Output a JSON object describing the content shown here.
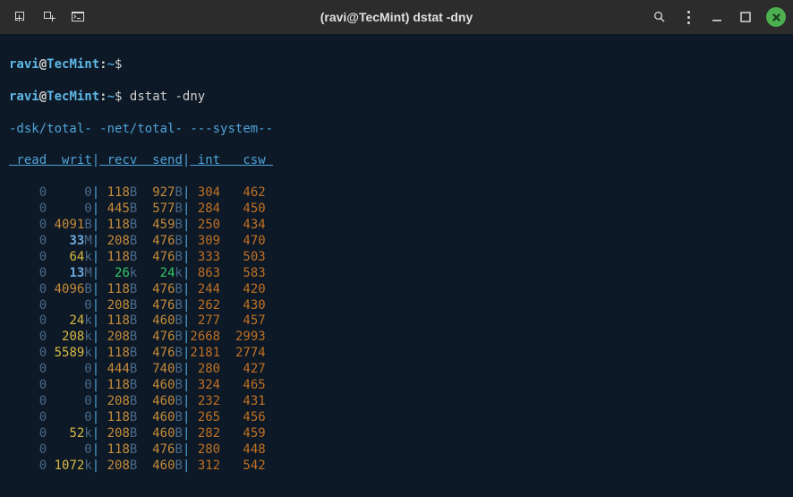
{
  "window": {
    "title": "(ravi@TecMint) dstat -dny"
  },
  "prompt": {
    "user": "ravi",
    "host": "TecMint",
    "path": "~",
    "symbol": "$"
  },
  "command": "dstat -dny",
  "groups": [
    {
      "label": "-dsk/total-",
      "cols": [
        "read",
        "writ"
      ]
    },
    {
      "label": "-net/total-",
      "cols": [
        "recv",
        "send"
      ]
    },
    {
      "label": "---system--",
      "cols": [
        "int",
        "csw"
      ]
    }
  ],
  "rows": [
    {
      "read": {
        "v": 0
      },
      "writ": {
        "v": 0
      },
      "recv": {
        "v": 118,
        "s": "B"
      },
      "send": {
        "v": 927,
        "s": "B"
      },
      "int": {
        "v": 304
      },
      "csw": {
        "v": 462
      }
    },
    {
      "read": {
        "v": 0
      },
      "writ": {
        "v": 0
      },
      "recv": {
        "v": 445,
        "s": "B"
      },
      "send": {
        "v": 577,
        "s": "B"
      },
      "int": {
        "v": 284
      },
      "csw": {
        "v": 450
      }
    },
    {
      "read": {
        "v": 0
      },
      "writ": {
        "v": 4091,
        "s": "B"
      },
      "recv": {
        "v": 118,
        "s": "B"
      },
      "send": {
        "v": 459,
        "s": "B"
      },
      "int": {
        "v": 250
      },
      "csw": {
        "v": 434
      }
    },
    {
      "read": {
        "v": 0
      },
      "writ": {
        "v": 33,
        "s": "M",
        "blue": true
      },
      "recv": {
        "v": 208,
        "s": "B"
      },
      "send": {
        "v": 476,
        "s": "B"
      },
      "int": {
        "v": 309
      },
      "csw": {
        "v": 470
      }
    },
    {
      "read": {
        "v": 0
      },
      "writ": {
        "v": 64,
        "s": "k",
        "y": true
      },
      "recv": {
        "v": 118,
        "s": "B"
      },
      "send": {
        "v": 476,
        "s": "B"
      },
      "int": {
        "v": 333
      },
      "csw": {
        "v": 503
      }
    },
    {
      "read": {
        "v": 0
      },
      "writ": {
        "v": 13,
        "s": "M",
        "blue": true
      },
      "recv": {
        "v": 26,
        "s": "k",
        "g": true
      },
      "send": {
        "v": 24,
        "s": "k",
        "g": true
      },
      "int": {
        "v": 863
      },
      "csw": {
        "v": 583
      }
    },
    {
      "read": {
        "v": 0
      },
      "writ": {
        "v": 4096,
        "s": "B"
      },
      "recv": {
        "v": 118,
        "s": "B"
      },
      "send": {
        "v": 476,
        "s": "B"
      },
      "int": {
        "v": 244
      },
      "csw": {
        "v": 420
      }
    },
    {
      "read": {
        "v": 0
      },
      "writ": {
        "v": 0
      },
      "recv": {
        "v": 208,
        "s": "B"
      },
      "send": {
        "v": 476,
        "s": "B"
      },
      "int": {
        "v": 262
      },
      "csw": {
        "v": 430
      }
    },
    {
      "read": {
        "v": 0
      },
      "writ": {
        "v": 24,
        "s": "k",
        "y": true
      },
      "recv": {
        "v": 118,
        "s": "B"
      },
      "send": {
        "v": 460,
        "s": "B"
      },
      "int": {
        "v": 277
      },
      "csw": {
        "v": 457
      }
    },
    {
      "read": {
        "v": 0
      },
      "writ": {
        "v": 208,
        "s": "k",
        "y": true
      },
      "recv": {
        "v": 208,
        "s": "B"
      },
      "send": {
        "v": 476,
        "s": "B"
      },
      "int": {
        "v": 2668
      },
      "csw": {
        "v": 2993
      }
    },
    {
      "read": {
        "v": 0
      },
      "writ": {
        "v": 5589,
        "s": "k",
        "y": true
      },
      "recv": {
        "v": 118,
        "s": "B"
      },
      "send": {
        "v": 476,
        "s": "B"
      },
      "int": {
        "v": 2181
      },
      "csw": {
        "v": 2774
      }
    },
    {
      "read": {
        "v": 0
      },
      "writ": {
        "v": 0
      },
      "recv": {
        "v": 444,
        "s": "B"
      },
      "send": {
        "v": 740,
        "s": "B"
      },
      "int": {
        "v": 280
      },
      "csw": {
        "v": 427
      }
    },
    {
      "read": {
        "v": 0
      },
      "writ": {
        "v": 0
      },
      "recv": {
        "v": 118,
        "s": "B"
      },
      "send": {
        "v": 460,
        "s": "B"
      },
      "int": {
        "v": 324
      },
      "csw": {
        "v": 465
      }
    },
    {
      "read": {
        "v": 0
      },
      "writ": {
        "v": 0
      },
      "recv": {
        "v": 208,
        "s": "B"
      },
      "send": {
        "v": 460,
        "s": "B"
      },
      "int": {
        "v": 232
      },
      "csw": {
        "v": 431
      }
    },
    {
      "read": {
        "v": 0
      },
      "writ": {
        "v": 0
      },
      "recv": {
        "v": 118,
        "s": "B"
      },
      "send": {
        "v": 460,
        "s": "B"
      },
      "int": {
        "v": 265
      },
      "csw": {
        "v": 456
      }
    },
    {
      "read": {
        "v": 0
      },
      "writ": {
        "v": 52,
        "s": "k",
        "y": true
      },
      "recv": {
        "v": 208,
        "s": "B"
      },
      "send": {
        "v": 460,
        "s": "B"
      },
      "int": {
        "v": 282
      },
      "csw": {
        "v": 459
      }
    },
    {
      "read": {
        "v": 0
      },
      "writ": {
        "v": 0
      },
      "recv": {
        "v": 118,
        "s": "B"
      },
      "send": {
        "v": 476,
        "s": "B"
      },
      "int": {
        "v": 280
      },
      "csw": {
        "v": 448
      }
    },
    {
      "read": {
        "v": 0
      },
      "writ": {
        "v": 1072,
        "s": "k",
        "y": true
      },
      "recv": {
        "v": 208,
        "s": "B"
      },
      "send": {
        "v": 460,
        "s": "B"
      },
      "int": {
        "v": 312
      },
      "csw": {
        "v": 542
      }
    }
  ]
}
